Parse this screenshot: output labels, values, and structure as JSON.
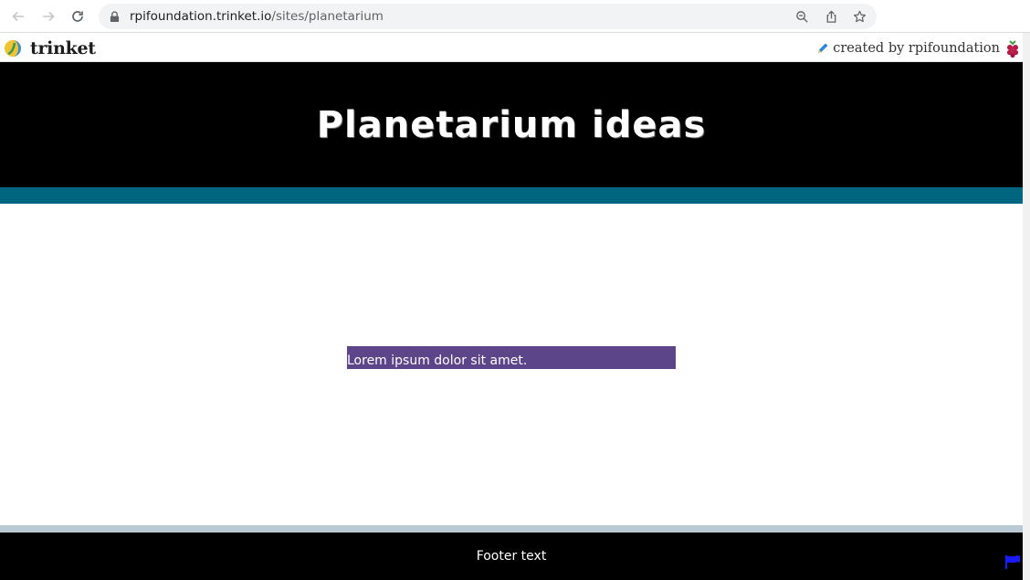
{
  "browser": {
    "url_host": "rpifoundation.trinket.io",
    "url_path": "/sites/planetarium",
    "icons": [
      "back-icon",
      "forward-icon",
      "reload-icon",
      "lock-icon",
      "zoom-icon",
      "share-icon",
      "bookmark-star-icon"
    ]
  },
  "trinket_bar": {
    "logo_text": "trinket",
    "creator_text": "created by rpifoundation"
  },
  "site": {
    "title": "Planetarium ideas",
    "content_text": "Lorem ipsum dolor sit amet.",
    "footer_text": "Footer text"
  },
  "colors": {
    "header_bg": "#000000",
    "header_stripe": "#006680",
    "content_box": "#5c4589",
    "footer_stripe": "#b8c9d3",
    "footer_bg": "#000000",
    "flag": "#1a1aff"
  }
}
